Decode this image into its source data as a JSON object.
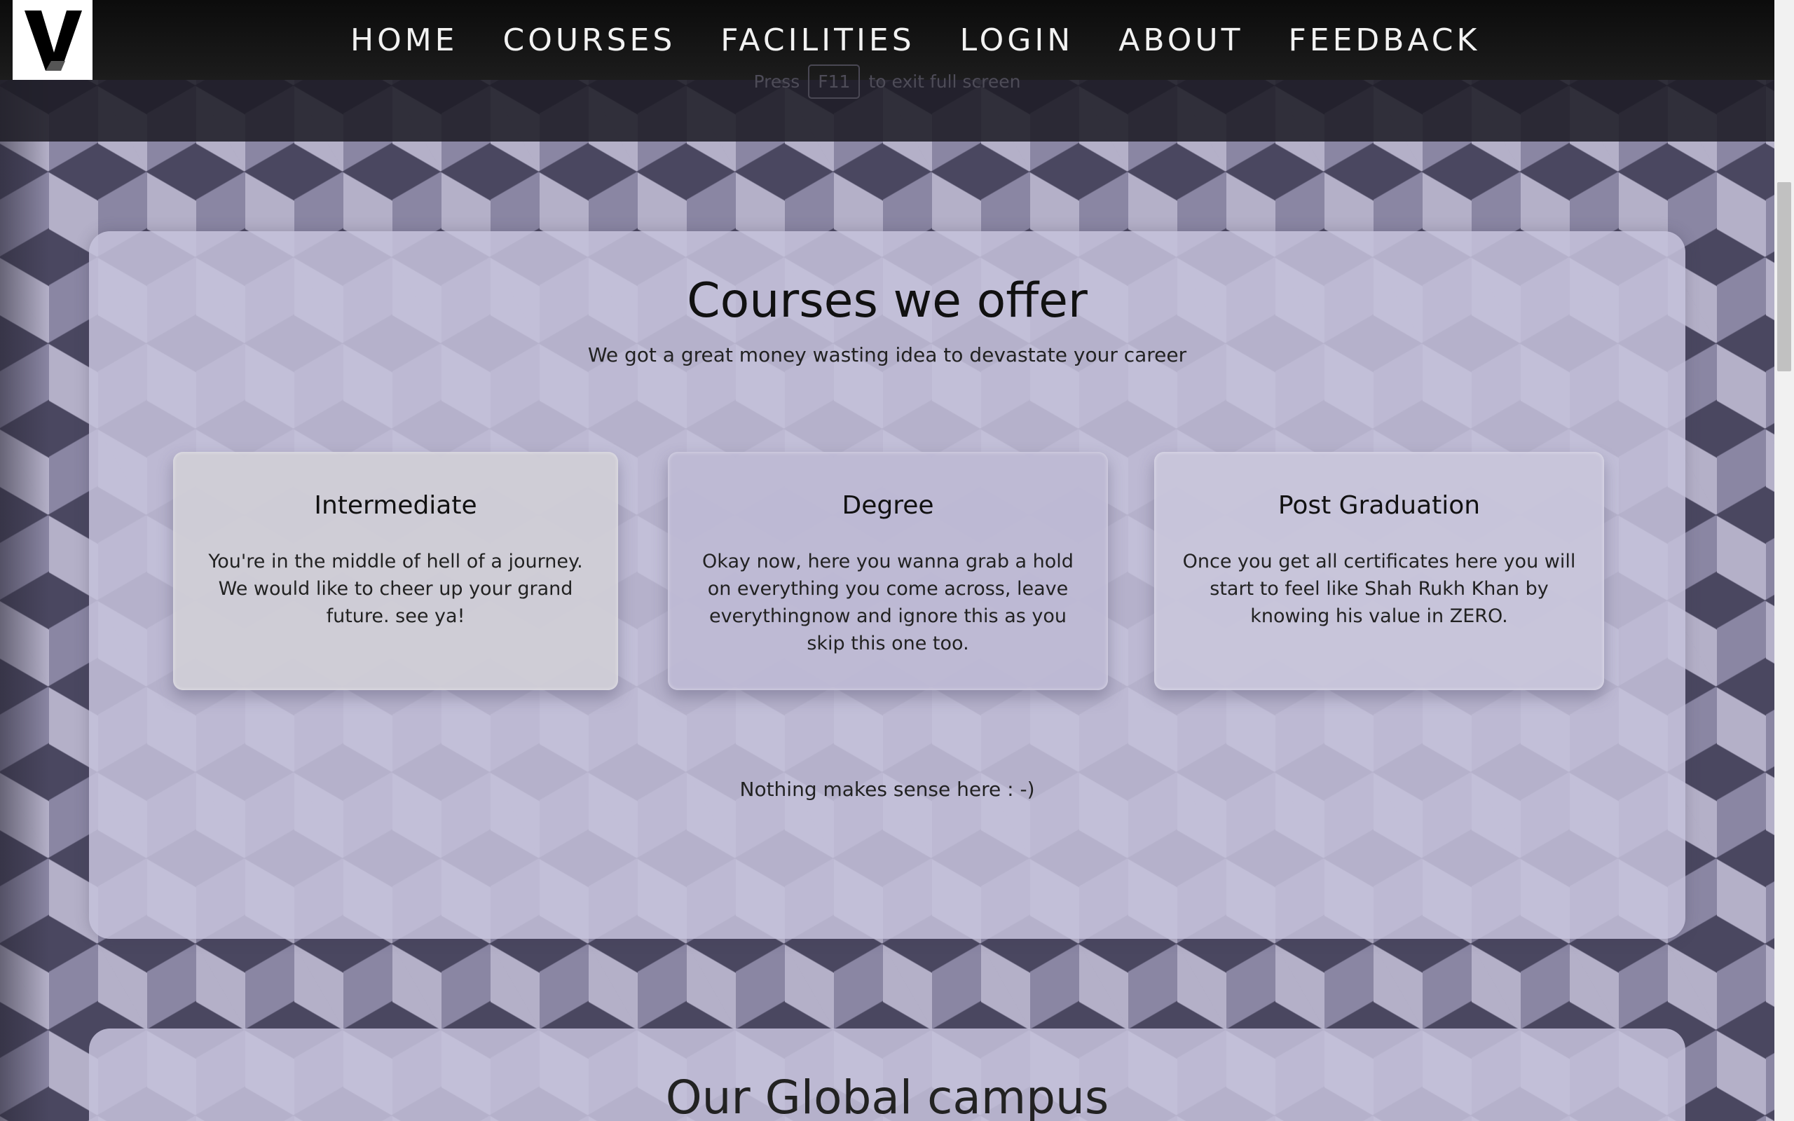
{
  "nav": {
    "logo_letter": "V",
    "items": [
      {
        "label": "HOME"
      },
      {
        "label": "COURSES"
      },
      {
        "label": "FACILITIES"
      },
      {
        "label": "LOGIN"
      },
      {
        "label": "ABOUT"
      },
      {
        "label": "FEEDBACK"
      }
    ]
  },
  "fullscreen_hint": {
    "prefix": "Press",
    "key": "F11",
    "suffix": "to exit full screen"
  },
  "courses": {
    "title": "Courses we offer",
    "subtitle": "We got a great money wasting idea to devastate your career",
    "cards": [
      {
        "title": "Intermediate",
        "text": "You're in the middle of hell of a journey. We would like to cheer up your grand future. see ya!"
      },
      {
        "title": "Degree",
        "text": "Okay now, here you wanna grab a hold on everything you come across, leave everythingnow and ignore this as you skip this one too."
      },
      {
        "title": "Post Graduation",
        "text": "Once you get all certificates here you will start to feel like Shah Rukh Khan by knowing his value in ZERO."
      }
    ],
    "footer": "Nothing makes sense here : -)"
  },
  "campus": {
    "title": "Our Global campus"
  },
  "colors": {
    "navbar": "#111111",
    "panel": "#c4c0da",
    "pattern_dark": "#4a4760",
    "pattern_light": "#b4b0c8"
  }
}
